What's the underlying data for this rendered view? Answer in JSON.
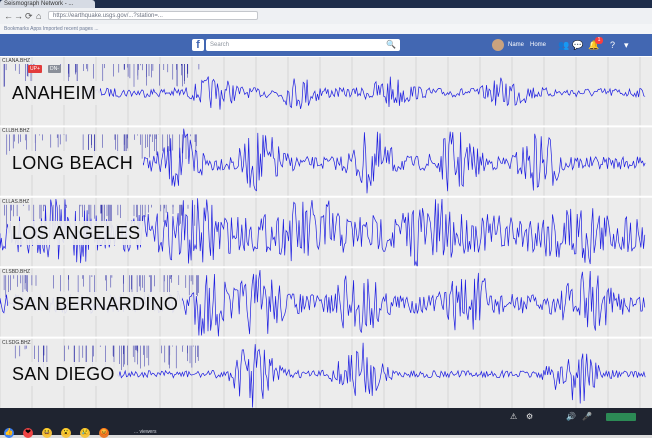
{
  "browser": {
    "tab_title": "Seismograph Network - ...",
    "address": "https://earthquake.usgs.gov/...?station=...",
    "bookmarks_text": "Bookmarks   Apps   Imported   recent pages   ...",
    "nav_back": "←",
    "nav_forward": "→",
    "nav_reload": "⟳",
    "nav_home": "⌂"
  },
  "facebook": {
    "logo": "f",
    "search_placeholder": "Search",
    "search_btn": "🔍",
    "profile_name": "Name",
    "home_label": "Home",
    "friends_icon": "👥",
    "messages_icon": "💬",
    "notifications_icon": "🔔",
    "notifications_badge": "1",
    "help_icon": "?",
    "menu_icon": "▾"
  },
  "seismograph": {
    "axis_controls": [
      {
        "label": "UP+",
        "color": "#e23b3b"
      },
      {
        "label": "DN-",
        "color": "#8a8f99"
      }
    ],
    "stations": [
      {
        "name": "ANAHEIM",
        "code": "CI.ANA.BHZ",
        "start_frac": 0.13,
        "amp": 0.13,
        "burst_at": [
          0.33,
          0.46,
          0.6,
          0.78
        ],
        "burst_amp": 0.38
      },
      {
        "name": "LONG BEACH",
        "code": "CI.LBH.BHZ",
        "start_frac": 0.22,
        "amp": 0.18,
        "burst_at": [
          0.28,
          0.4,
          0.57,
          0.7,
          0.83
        ],
        "burst_amp": 0.8
      },
      {
        "name": "LOS ANGELES",
        "code": "CI.LAS.BHZ",
        "start_frac": 0.0,
        "amp": 0.55,
        "burst_at": [
          0.1,
          0.3,
          0.48,
          0.66,
          0.88
        ],
        "burst_amp": 0.95
      },
      {
        "name": "SAN BERNARDINO",
        "code": "CI.SBD.BHZ",
        "start_frac": 0.0,
        "amp": 0.28,
        "burst_at": [
          0.32,
          0.4,
          0.55,
          0.72,
          0.9
        ],
        "burst_amp": 0.85
      },
      {
        "name": "SAN DIEGO",
        "code": "CI.SDG.BHZ",
        "start_frac": 0.18,
        "amp": 0.1,
        "burst_at": [
          0.39,
          0.55,
          0.88
        ],
        "burst_amp": 0.95
      }
    ],
    "trace_color": "#1d1de0",
    "grid_color": "#c8c8c8",
    "tick_color": "#2a2aa6"
  },
  "livebar": {
    "reactions": [
      {
        "glyph": "👍",
        "color": "#3b82f6"
      },
      {
        "glyph": "❤",
        "color": "#ef4444"
      },
      {
        "glyph": "😆",
        "color": "#f5c542"
      },
      {
        "glyph": "😮",
        "color": "#f5c542"
      },
      {
        "glyph": "😢",
        "color": "#f5c542"
      },
      {
        "glyph": "😡",
        "color": "#e97a2a"
      }
    ],
    "viewer_text": "... viewers",
    "tray_icons": [
      "⚠",
      "⚙",
      "🔊",
      "🎤"
    ]
  }
}
